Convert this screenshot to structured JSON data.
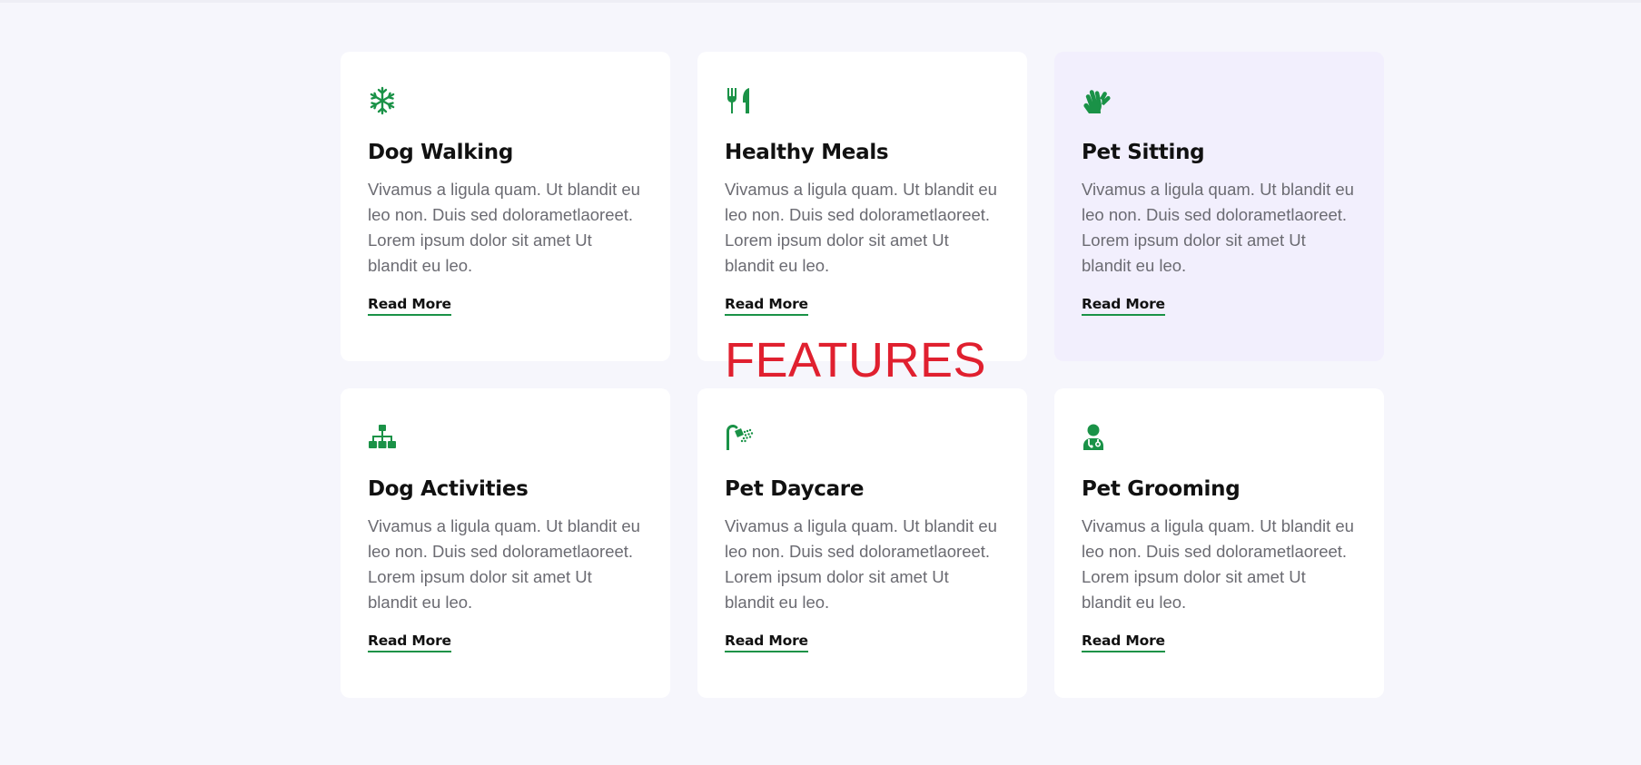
{
  "colors": {
    "accent": "#1a9247",
    "page_background": "#f6f6fc",
    "card_background": "#ffffff",
    "card_active_background": "#f2effd",
    "overlay_label": "#e0202f"
  },
  "overlay_label": "FEATURES",
  "cards": [
    {
      "icon": "snowflake-icon",
      "title": "Dog Walking",
      "text_lines": [
        "Vivamus a ligula quam. Ut blandit eu",
        "leo non. Duis sed dolorametlaoreet.",
        "Lorem ipsum dolor sit amet Ut",
        "blandit eu leo."
      ],
      "link": "Read More"
    },
    {
      "icon": "utensils-icon",
      "title": "Healthy Meals",
      "text_lines": [
        "Vivamus a ligula quam. Ut blandit eu",
        "leo non. Duis sed dolorametlaoreet.",
        "Lorem ipsum dolor sit amet Ut",
        "blandit eu leo."
      ],
      "link": "Read More"
    },
    {
      "icon": "hands-icon",
      "title": "Pet Sitting",
      "text_lines": [
        "Vivamus a ligula quam. Ut blandit eu",
        "leo non. Duis sed dolorametlaoreet.",
        "Lorem ipsum dolor sit amet Ut",
        "blandit eu leo."
      ],
      "link": "Read More"
    },
    {
      "icon": "sitemap-icon",
      "title": "Dog Activities",
      "text_lines": [
        "Vivamus a ligula quam. Ut blandit eu",
        "leo non. Duis sed dolorametlaoreet.",
        "Lorem ipsum dolor sit amet Ut",
        "blandit eu leo."
      ],
      "link": "Read More"
    },
    {
      "icon": "shower-icon",
      "title": "Pet Daycare",
      "text_lines": [
        "Vivamus a ligula quam. Ut blandit eu",
        "leo non. Duis sed dolorametlaoreet.",
        "Lorem ipsum dolor sit amet Ut",
        "blandit eu leo."
      ],
      "link": "Read More"
    },
    {
      "icon": "user-doctor-icon",
      "title": "Pet Grooming",
      "text_lines": [
        "Vivamus a ligula quam. Ut blandit eu",
        "leo non. Duis sed dolorametlaoreet.",
        "Lorem ipsum dolor sit amet Ut",
        "blandit eu leo."
      ],
      "link": "Read More"
    }
  ]
}
